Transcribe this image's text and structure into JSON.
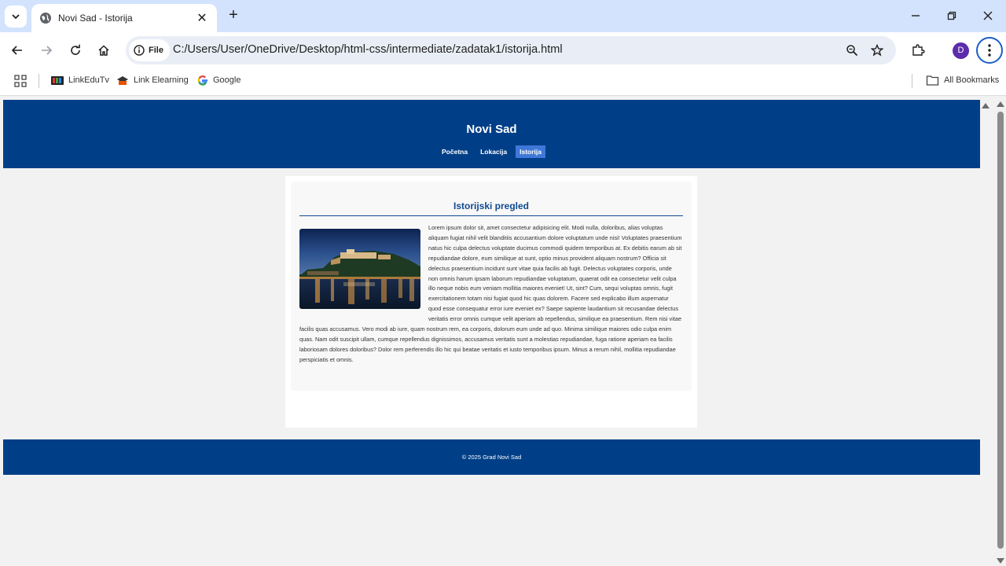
{
  "browser": {
    "tab_title": "Novi Sad - Istorija",
    "site_chip_label": "File",
    "url": "C:/Users/User/OneDrive/Desktop/html-css/intermediate/zadatak1/istorija.html",
    "profile_initial": "D",
    "bookmarks": [
      {
        "label": "LinkEduTv",
        "icon": "linkedutv-icon"
      },
      {
        "label": "Link Elearning",
        "icon": "link-elearning-icon"
      },
      {
        "label": "Google",
        "icon": "google-icon"
      }
    ],
    "all_bookmarks_label": "All Bookmarks"
  },
  "site": {
    "title": "Novi Sad",
    "nav": [
      "Početna",
      "Lokacija",
      "Istorija"
    ],
    "active_nav": "Istorija",
    "section_title": "Istorijski pregled",
    "body": "Lorem ipsum dolor sit, amet consectetur adipisicing elit. Modi nulla, doloribus, alias voluptas aliquam fugiat nihil velit blanditiis accusantium dolore voluptatum unde nisi! Voluptates praesentium natus hic culpa delectus voluptate ducimus commodi quidem temporibus at. Ex debitis earum ab sit repudiandae dolore, eum similique at sunt, optio minus provident aliquam nostrum? Officia sit delectus praesentium incidunt sunt vitae quia facilis ab fugit. Delectus voluptates corporis, unde non omnis harum ipsam laborum repudiandae voluptatum, quaerat odit ea consectetur velit culpa illo neque nobis eum veniam mollitia maiores eveniet! Ut, sint? Cum, sequi voluptas omnis, fugit exercitationem totam nisi fugiat quod hic quas dolorem. Facere sed explicabo illum aspernatur quod esse consequatur error iure eveniet ex? Saepe sapiente laudantium sit recusandae delectus veritatis error omnis cumque velit aperiam ab repellendus, similique ea praesentium. Rem nisi vitae facilis quas accusamus. Vero modi ab iure, quam nostrum rem, ea corporis, dolorum eum unde ad quo. Minima similique maiores odio culpa enim quas. Nam odit suscipit ullam, cumque repellendus dignissimos, accusamus veritatis sunt a molestias repudiandae, fuga ratione aperiam ea facilis laboriosam dolores doloribus? Dolor rem perferendis illo hic qui beatae veritatis et iusto temporibus ipsum. Minus a rerum nihil, mollitia repudiandae perspiciatis et omnis.",
    "footer": "© 2025 Grad Novi Sad"
  },
  "colors": {
    "header_bg": "#003f87",
    "active_nav_bg": "#3f78d8",
    "section_title": "#0f4a8f",
    "tabstrip_bg": "#d3e3fd"
  }
}
